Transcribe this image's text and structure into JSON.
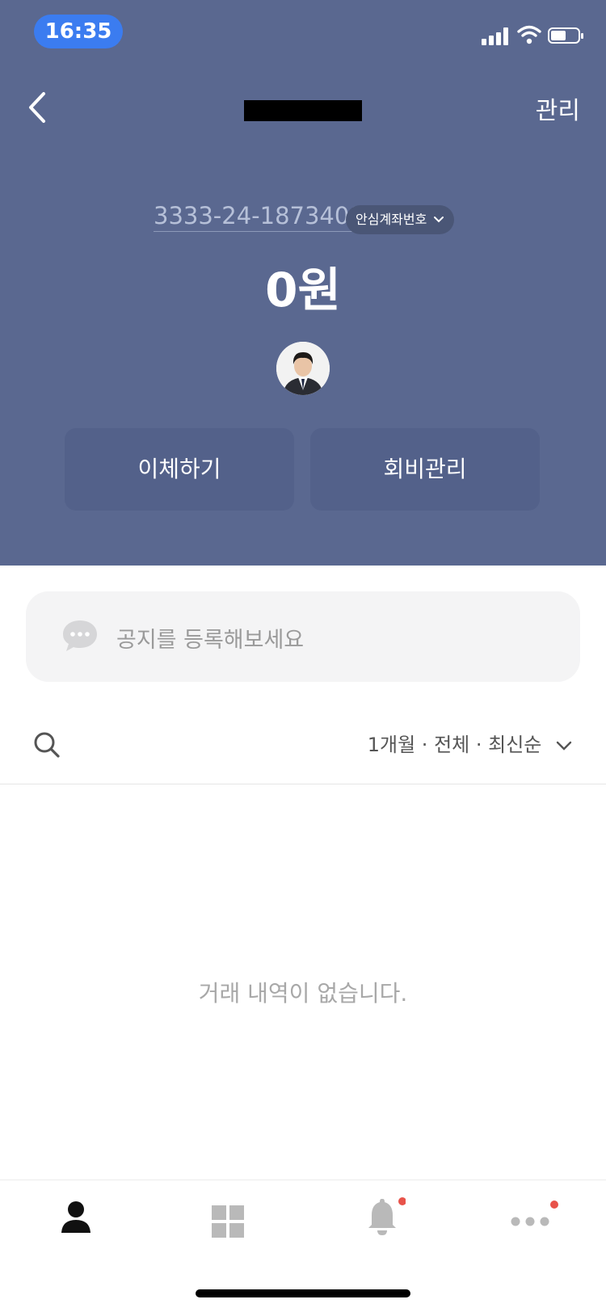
{
  "status_bar": {
    "time": "16:35"
  },
  "nav": {
    "title": "",
    "manage_label": "관리"
  },
  "account": {
    "number": "3333-24-1873409",
    "safe_number_label": "안심계좌번호",
    "balance": "0원"
  },
  "actions": {
    "transfer_label": "이체하기",
    "dues_label": "회비관리"
  },
  "notice": {
    "placeholder": "공지를 등록해보세요"
  },
  "filter": {
    "label": "1개월 · 전체 · 최신순"
  },
  "transactions": {
    "empty_message": "거래 내역이 없습니다."
  },
  "tab_bar": {
    "tabs": [
      {
        "icon": "person-icon"
      },
      {
        "icon": "grid-icon"
      },
      {
        "icon": "bell-icon",
        "badge_color": "#e8534a"
      },
      {
        "icon": "more-icon",
        "badge_color": "#e8534a"
      }
    ]
  },
  "colors": {
    "header_bg": "#5a6890",
    "accent_badge": "#e8534a",
    "status_time_bg": "#3b7cf0"
  }
}
